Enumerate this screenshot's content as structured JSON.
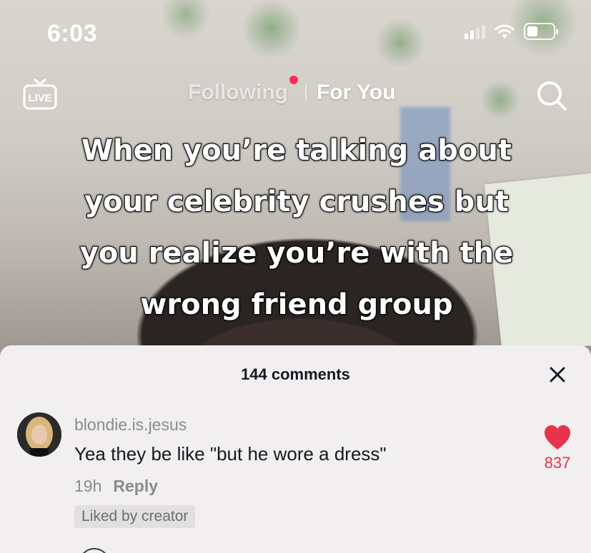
{
  "status_bar": {
    "time": "6:03"
  },
  "top_nav": {
    "live_label": "LIVE",
    "tabs": [
      {
        "label": "Following",
        "active": false,
        "has_notification_dot": true
      },
      {
        "label": "For You",
        "active": true
      }
    ]
  },
  "video": {
    "caption_lines": [
      "When you’re talking about",
      "your celebrity crushes but",
      "you realize you’re with the",
      "wrong friend group"
    ]
  },
  "comments_sheet": {
    "title": "144 comments",
    "comments": [
      {
        "username": "blondie.is.jesus",
        "text": "Yea they be like \"but he wore a dress\"",
        "time": "19h",
        "reply_label": "Reply",
        "badge": "Liked by creator",
        "like_count": "837",
        "liked": true
      }
    ]
  },
  "colors": {
    "accent_red": "#fe2c55",
    "like_red": "#e8334d",
    "sheet_bg": "#f1efef",
    "text_primary": "#161823",
    "text_secondary": "#8a8b91"
  }
}
